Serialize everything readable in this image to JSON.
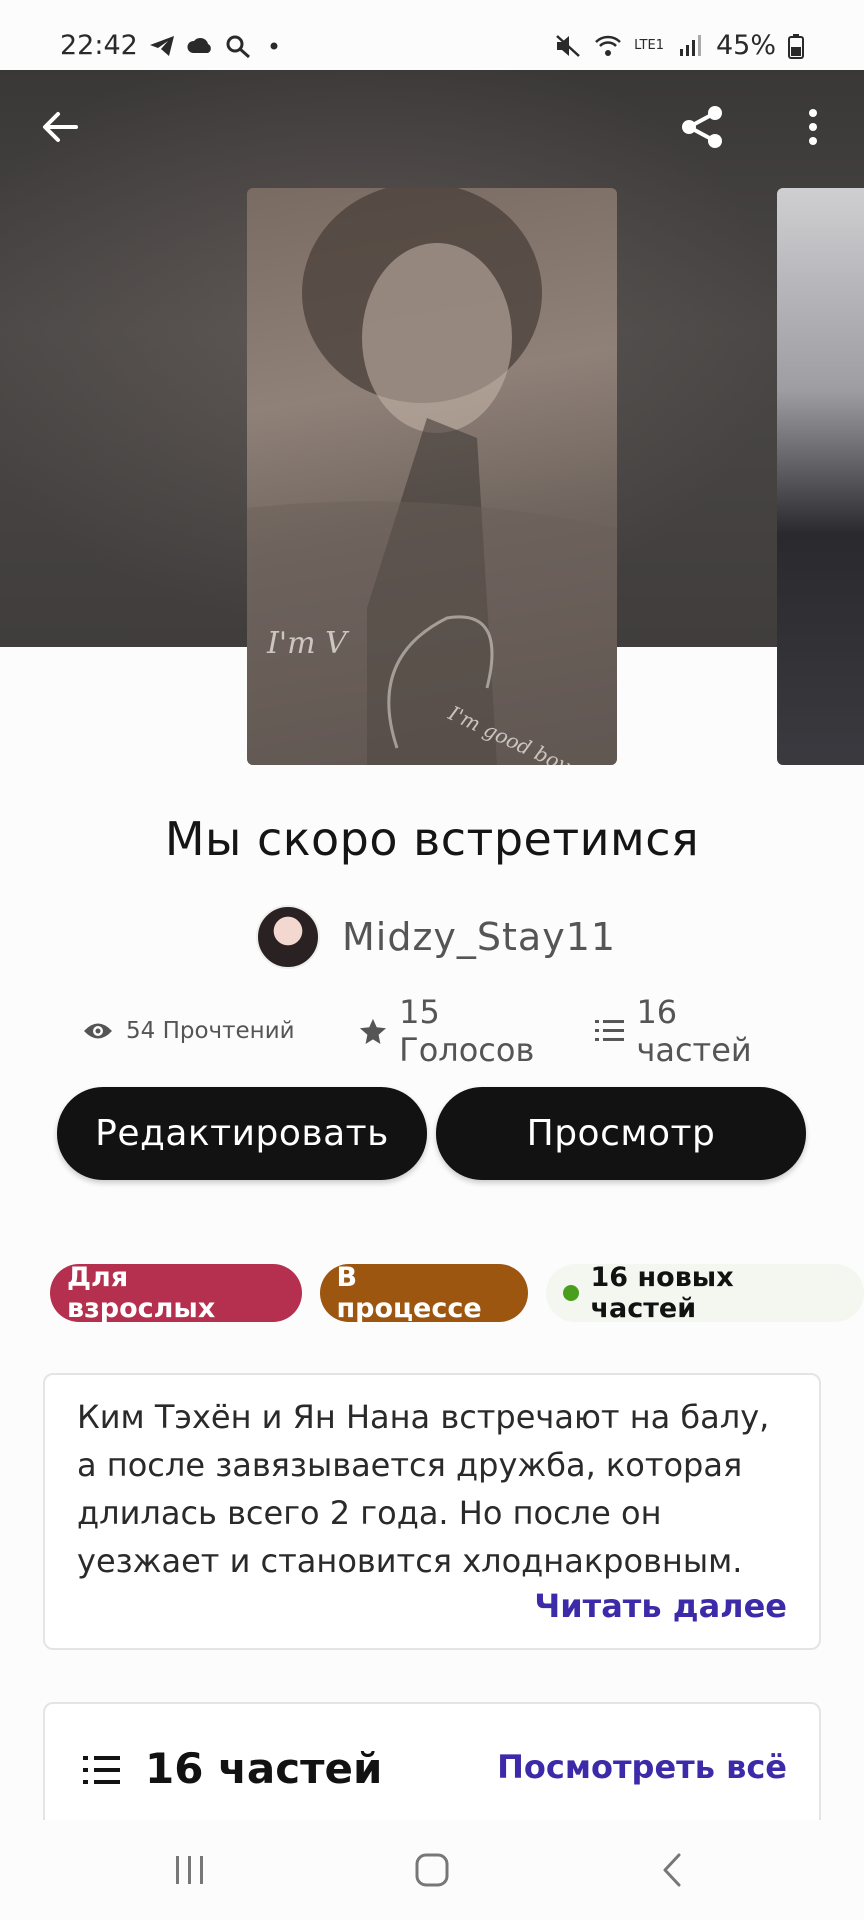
{
  "status_bar": {
    "time": "22:42",
    "battery": "45%",
    "network": "LTE1"
  },
  "header": {
    "back_icon": "arrow-left-icon",
    "share_icon": "share-icon",
    "more_icon": "more-vertical-icon"
  },
  "story": {
    "title": "Мы скоро встретимся",
    "author": "Midzy_Stay11",
    "cover_text_1": "I'm V",
    "cover_text_2": "I'm good boy"
  },
  "stats": {
    "reads": "54 Прочтений",
    "votes": "15 Голосов",
    "parts": "16 частей"
  },
  "actions": {
    "edit_label": "Редактировать",
    "preview_label": "Просмотр"
  },
  "tags": {
    "adult": "Для взрослых",
    "adult_color": "#b5304f",
    "in_progress": "В процессе",
    "in_progress_color": "#9c5610",
    "new_parts": "16 новых частей"
  },
  "description": {
    "text": "Ким Тэхён и Ян Нана  встречают на балу, а после завязывается дружба, которая длилась всего 2 года. Но после он уезжает и становится хлоднакровным.",
    "read_more": "Читать далее"
  },
  "parts_section": {
    "title": "16 частей",
    "see_all": "Посмотреть всё"
  },
  "colors": {
    "accent": "#3d2aa8",
    "button_bg": "#121212"
  }
}
